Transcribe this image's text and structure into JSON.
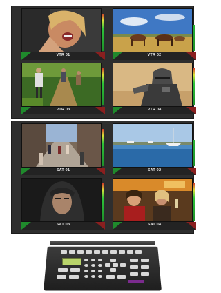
{
  "monitor_wall_1": {
    "sources": [
      {
        "label": "VTR 01",
        "image": "woman-laughing"
      },
      {
        "label": "VTR 02",
        "image": "horses-running"
      },
      {
        "label": "VTR 03",
        "image": "hikers-in-forest"
      },
      {
        "label": "VTR 04",
        "image": "armored-knight"
      }
    ]
  },
  "monitor_wall_2": {
    "sources": [
      {
        "label": "SAT 01",
        "image": "city-street-crowd"
      },
      {
        "label": "SAT 02",
        "image": "harbor-boats"
      },
      {
        "label": "SAT 03",
        "image": "hooded-figure"
      },
      {
        "label": "SAT 04",
        "image": "people-at-bar"
      }
    ]
  },
  "keypad": {
    "badge": "",
    "device": "control-keypad"
  },
  "colors": {
    "panel": "#2e2e2e",
    "tally_green": "#1f8a2c",
    "tally_red": "#8a1f1f",
    "badge": "#7b2b8e"
  }
}
